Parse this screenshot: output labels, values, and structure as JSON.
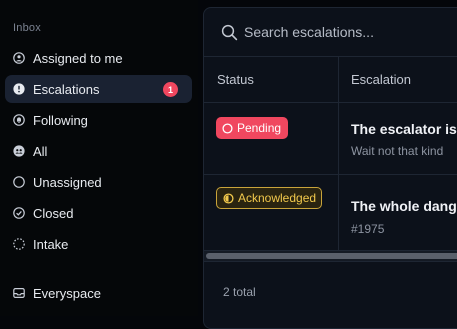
{
  "sidebar": {
    "heading": "Inbox",
    "items": [
      {
        "label": "Assigned to me",
        "icon": "user-circle-icon"
      },
      {
        "label": "Escalations",
        "icon": "alert-circle-icon",
        "count": "1",
        "active": true
      },
      {
        "label": "Following",
        "icon": "bell-circle-icon"
      },
      {
        "label": "All",
        "icon": "users-circle-icon"
      },
      {
        "label": "Unassigned",
        "icon": "empty-circle-icon"
      },
      {
        "label": "Closed",
        "icon": "check-circle-icon"
      },
      {
        "label": "Intake",
        "icon": "dashed-circle-icon"
      }
    ],
    "everyspace": {
      "label": "Everyspace",
      "icon": "inbox-tray-icon"
    }
  },
  "search": {
    "placeholder": "Search escalations..."
  },
  "table": {
    "columns": [
      "Status",
      "Escalation"
    ],
    "rows": [
      {
        "status": "Pending",
        "title": "The escalator is",
        "subtitle": "Wait not that kind",
        "status_color": "#f0475f"
      },
      {
        "status": "Acknowledged",
        "title": "The whole dang",
        "subtitle": "#1975",
        "status_color": "#f2c94c"
      }
    ]
  },
  "footer": {
    "total": "2 total"
  },
  "colors": {
    "accent_active_bg": "#1a2232",
    "badge_red": "#f0475f",
    "badge_yellow": "#f2c94c"
  }
}
